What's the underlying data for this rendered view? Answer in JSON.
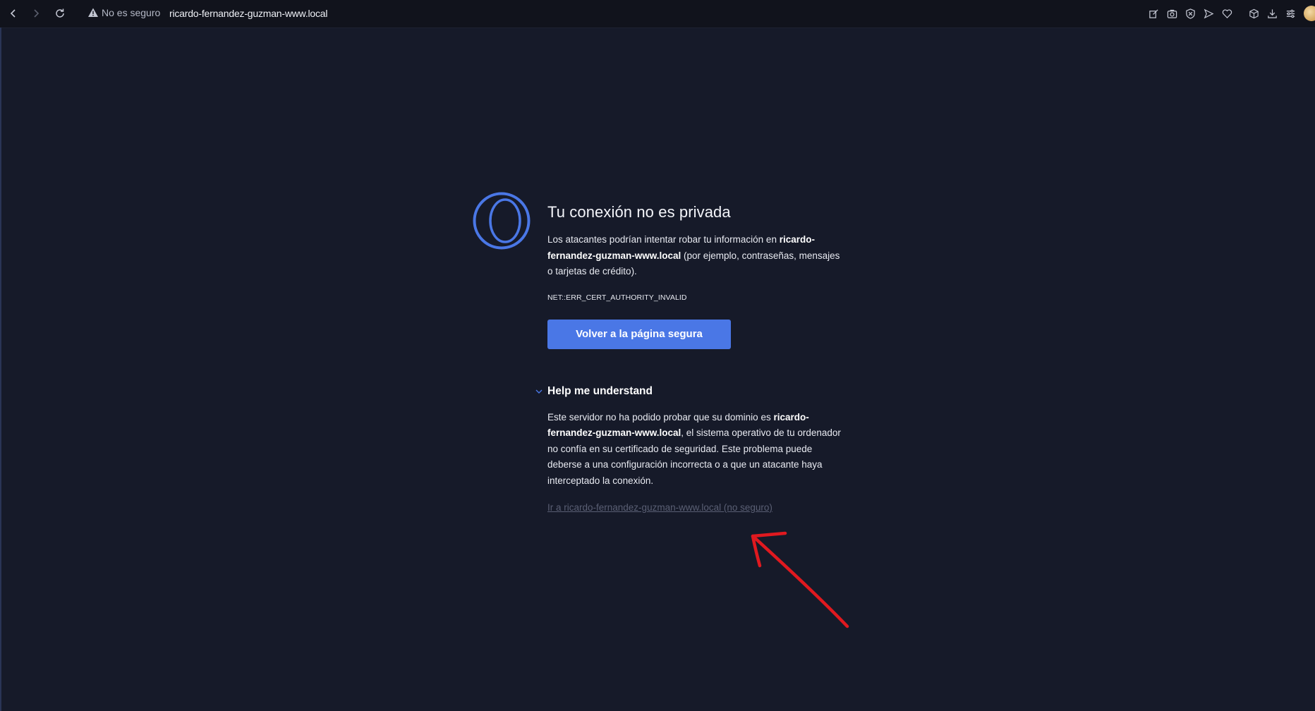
{
  "toolbar": {
    "security_label": "No es seguro",
    "url": "ricardo-fernandez-guzman-www.local"
  },
  "page": {
    "title": "Tu conexión no es privada",
    "intro_before": "Los atacantes podrían intentar robar tu información en ",
    "intro_domain": "ricardo-fernandez-guzman-www.local",
    "intro_after": " (por ejemplo, contraseñas, mensajes o tarjetas de crédito).",
    "error_code": "NET::ERR_CERT_AUTHORITY_INVALID",
    "back_button": "Volver a la página segura",
    "details_title": "Help me understand",
    "details_before": "Este servidor no ha podido probar que su dominio es ",
    "details_domain": "ricardo-fernandez-guzman-www.local",
    "details_after": ", el sistema operativo de tu ordenador no confía en su certificado de seguridad. Este problema puede deberse a una configuración incorrecta o a que un atacante haya interceptado la conexión.",
    "proceed_link": "Ir a ricardo-fernandez-guzman-www.local (no seguro)"
  },
  "colors": {
    "background": "#161a29",
    "accent": "#4a77e6",
    "annotation": "#e0191f"
  }
}
